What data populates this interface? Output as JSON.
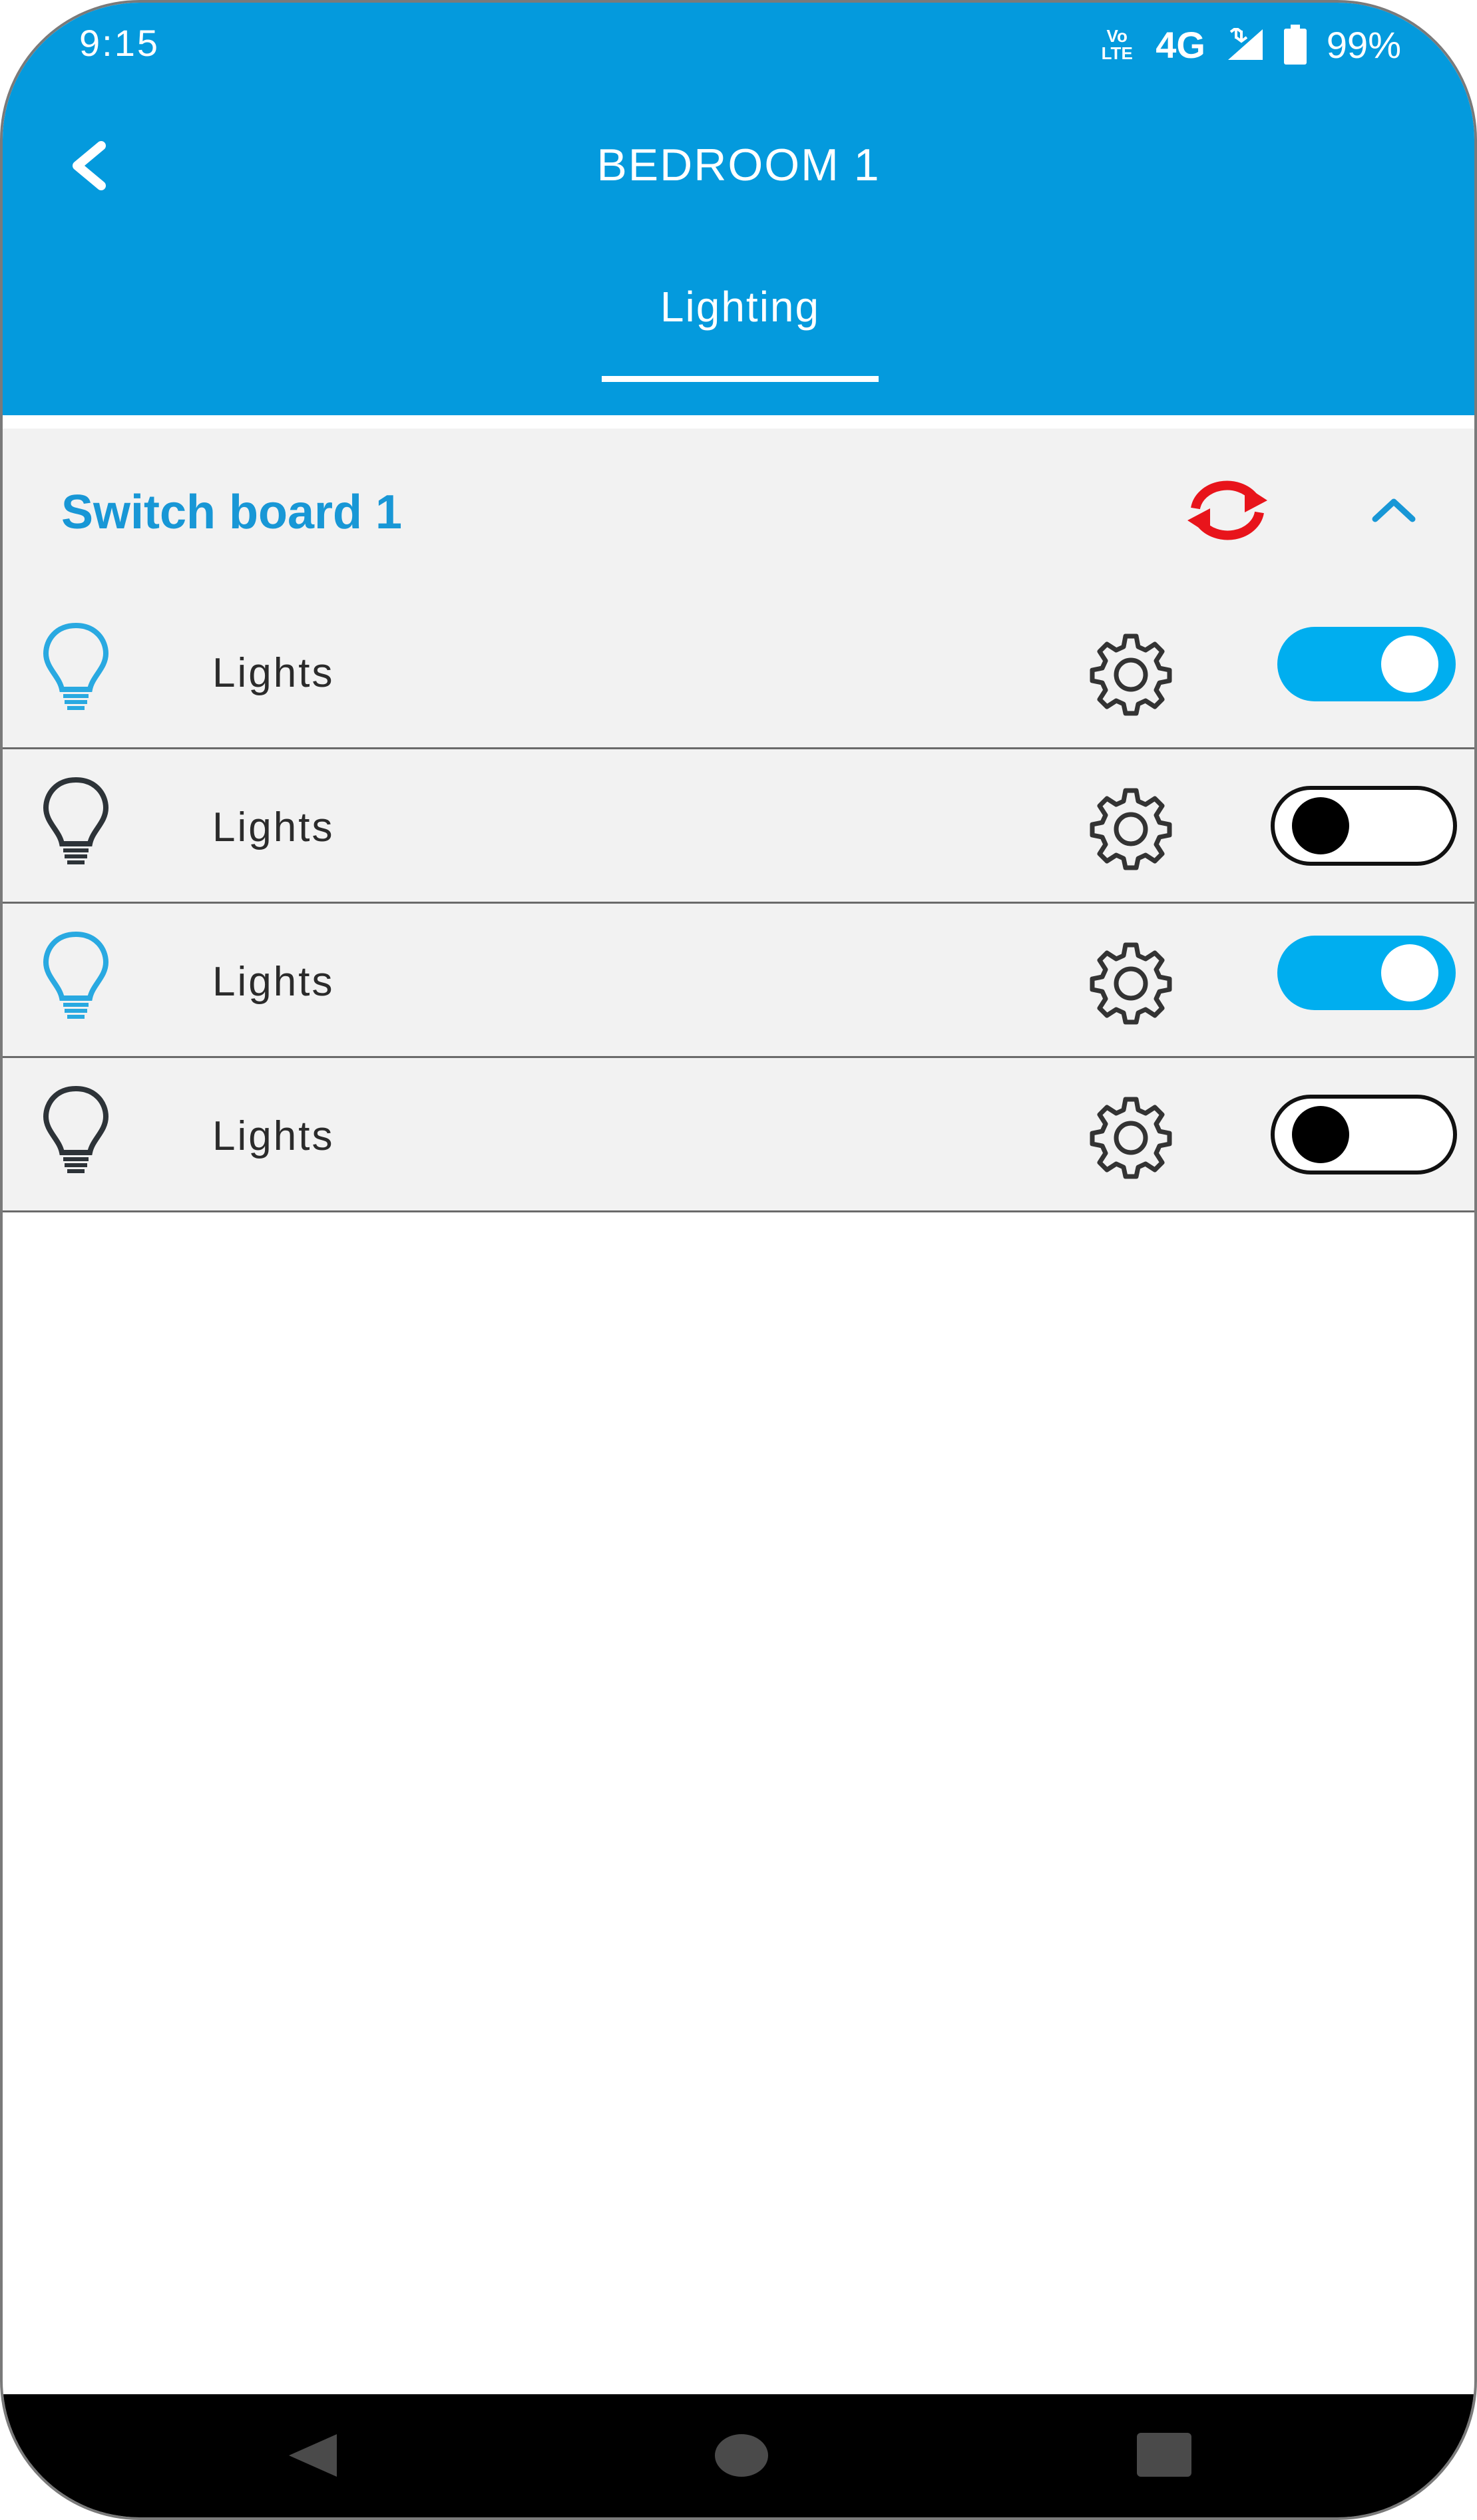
{
  "status_bar": {
    "time": "9:15",
    "volte": "Vo LTE",
    "network": "4G",
    "battery": "99%"
  },
  "header": {
    "title": "BEDROOM 1",
    "back_icon": "chevron-left-icon"
  },
  "tabs": [
    {
      "label": "Lighting",
      "active": true
    }
  ],
  "switch_board": {
    "title": "Switch board 1",
    "refresh_icon": "refresh-icon",
    "collapse_icon": "chevron-up-icon",
    "refresh_color": "#e8141b",
    "items": [
      {
        "label": "Lights",
        "on": true
      },
      {
        "label": "Lights",
        "on": false
      },
      {
        "label": "Lights",
        "on": true
      },
      {
        "label": "Lights",
        "on": false
      }
    ]
  },
  "colors": {
    "accent": "#049add",
    "toggle_on": "#00aeef",
    "title_text": "#1897d6"
  },
  "nav_bar": {
    "icons": [
      "back-triangle-icon",
      "home-circle-icon",
      "recents-square-icon"
    ]
  }
}
